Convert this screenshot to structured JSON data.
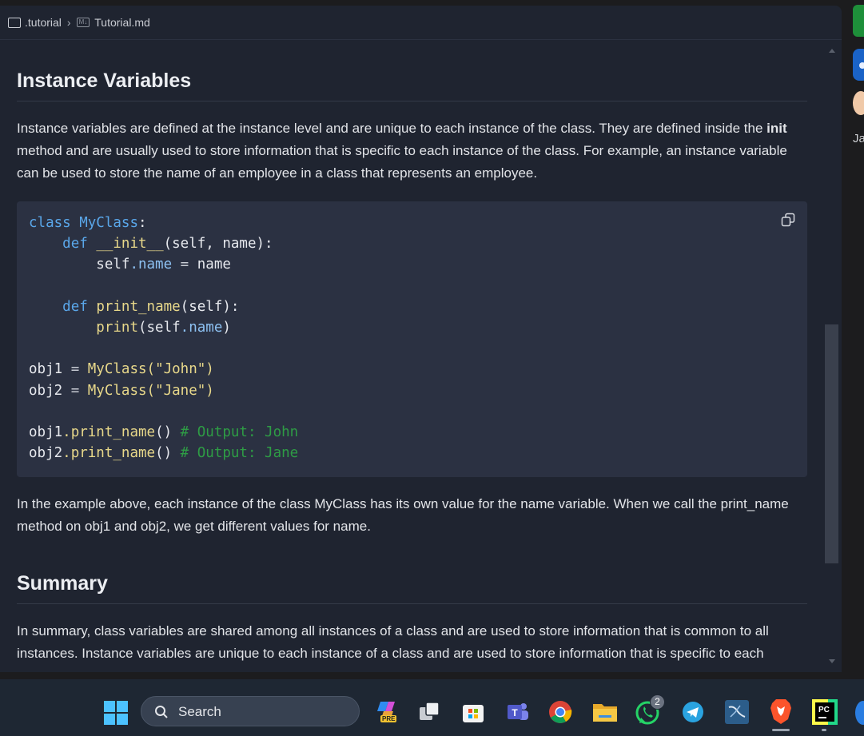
{
  "breadcrumb": {
    "folder": ".tutorial",
    "separator": "›",
    "md_badge": "M↓",
    "file": "Tutorial.md"
  },
  "doc": {
    "heading_instance": "Instance Variables",
    "p1_part1": "Instance variables are defined at the instance level and are unique to each instance of the class. They are defined inside the ",
    "p1_bold": "init",
    "p1_part2": " method and are usually used to store information that is specific to each instance of the class. For example, an instance variable can be used to store the name of an employee in a class that represents an employee.",
    "p2": "In the example above, each instance of the class MyClass has its own value for the name variable. When we call the print_name method on obj1 and obj2, we get different values for name.",
    "heading_summary": "Summary",
    "p3": "In summary, class variables are shared among all instances of a class and are used to store information that is common to all instances. Instance variables are unique to each instance of a class and are used to store information that is specific to each"
  },
  "code": {
    "line1_kw": "class",
    "line1_name": "MyClass",
    "line1_end": ":",
    "line2_kw": "def",
    "line2_fn": "__init__",
    "line2_args": "(self, name):",
    "line3_a": "self",
    "line3_b": ".name",
    "line3_c": " = ",
    "line3_d": "name",
    "line5_kw": "def",
    "line5_fn": "print_name",
    "line5_args": "(self):",
    "line6_fn": "print",
    "line6_a": "(self",
    "line6_b": ".name",
    "line6_c": ")",
    "line8_var": "obj1",
    "line8_eq": " = ",
    "line8_cls": "MyClass",
    "line8_arg": "(\"John\")",
    "line9_var": "obj2",
    "line9_eq": " = ",
    "line9_cls": "MyClass",
    "line9_arg": "(\"Jane\")",
    "line11_var": "obj1",
    "line11_call": ".print_name",
    "line11_paren": "()",
    "line11_cm": " # Output: John",
    "line12_var": "obj2",
    "line12_call": ".print_name",
    "line12_paren": "()",
    "line12_cm": " # Output: Jane"
  },
  "right_strip": {
    "text": "Ja"
  },
  "taskbar": {
    "search_label": "Search",
    "whatsapp_badge": "2",
    "copilot_badge": "PRE"
  }
}
